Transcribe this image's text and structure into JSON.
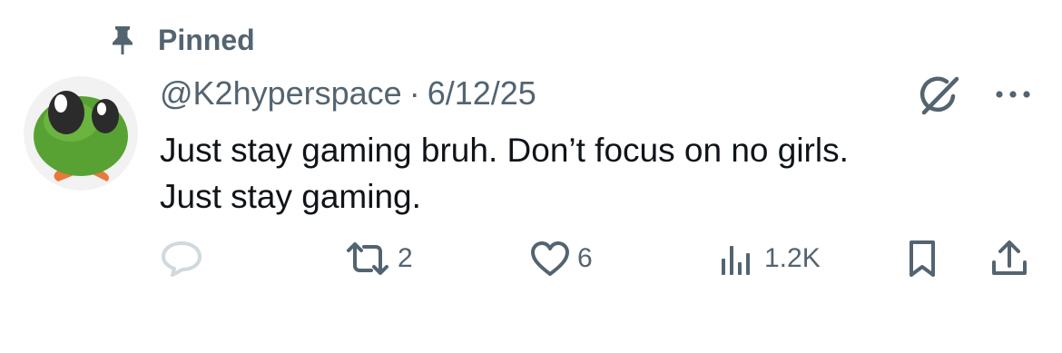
{
  "pinned": {
    "label": "Pinned",
    "icon": "pin-icon"
  },
  "tweet": {
    "handle": "@K2hyperspace",
    "separator": "·",
    "date": "6/12/25",
    "text_lines": [
      "Just stay gaming bruh. Don’t focus on no girls.",
      "Just stay gaming."
    ]
  },
  "actions": {
    "reply": {
      "icon": "reply-icon"
    },
    "retweet": {
      "icon": "retweet-icon",
      "count": "2"
    },
    "like": {
      "icon": "heart-icon",
      "count": "6"
    },
    "views": {
      "icon": "views-icon",
      "count": "1.2K"
    },
    "bookmark": {
      "icon": "bookmark-icon"
    },
    "share": {
      "icon": "share-icon"
    }
  },
  "colors": {
    "text_primary": "#0f1419",
    "text_secondary": "#536471",
    "reply_icon": "#cfd9de",
    "avatar_green": "#5aa336"
  }
}
